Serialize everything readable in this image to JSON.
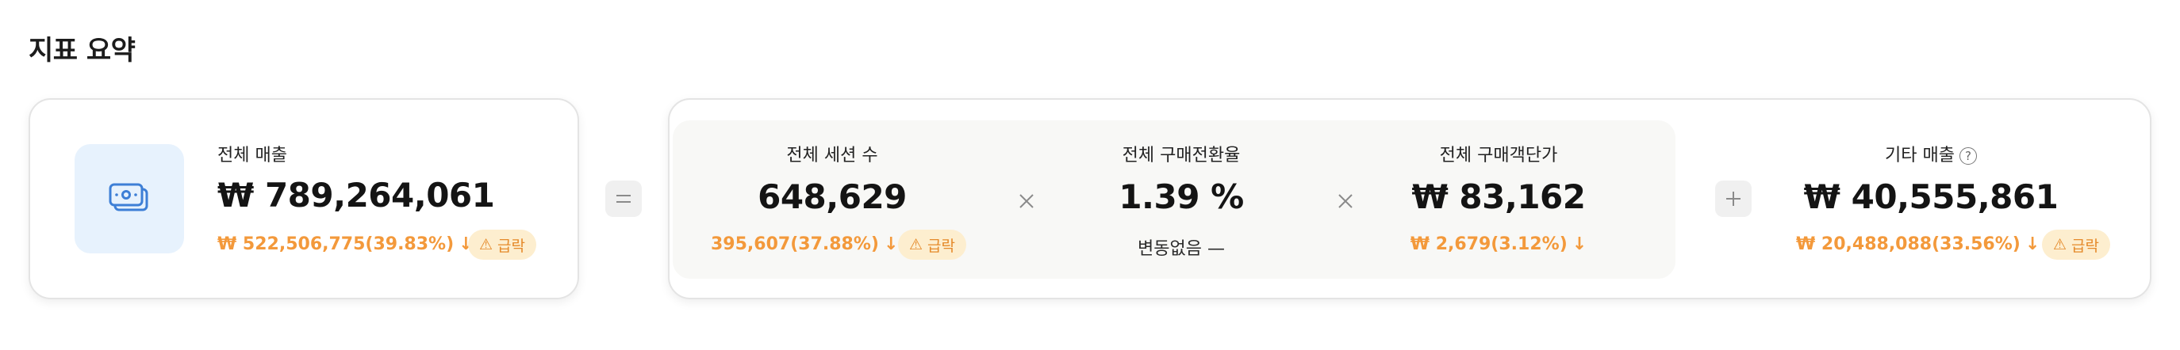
{
  "section_title": "지표 요약",
  "total_revenue": {
    "label": "전체 매출",
    "value": "₩ 789,264,061",
    "change": "₩ 522,506,775(39.83%)",
    "badge": "급락",
    "icon": "money-icon"
  },
  "sessions": {
    "label": "전체 세션 수",
    "value": "648,629",
    "change": "395,607(37.88%)",
    "badge": "급락"
  },
  "conversion": {
    "label": "전체 구매전환율",
    "value": "1.39 %",
    "change": "변동없음 —"
  },
  "avg_order": {
    "label": "전체 구매객단가",
    "value": "₩ 83,162",
    "change": "₩ 2,679(3.12%)"
  },
  "other_revenue": {
    "label": "기타 매출",
    "help": "?",
    "value": "₩ 40,555,861",
    "change": "₩ 20,488,088(33.56%)",
    "badge": "급락"
  },
  "operators": {
    "equals": "=",
    "times": "×",
    "plus": "+"
  },
  "colors": {
    "accent_orange": "#f3993b",
    "badge_bg": "#fdeecf",
    "icon_bg": "#e7f2fd",
    "icon_blue": "#3d7fd6"
  }
}
